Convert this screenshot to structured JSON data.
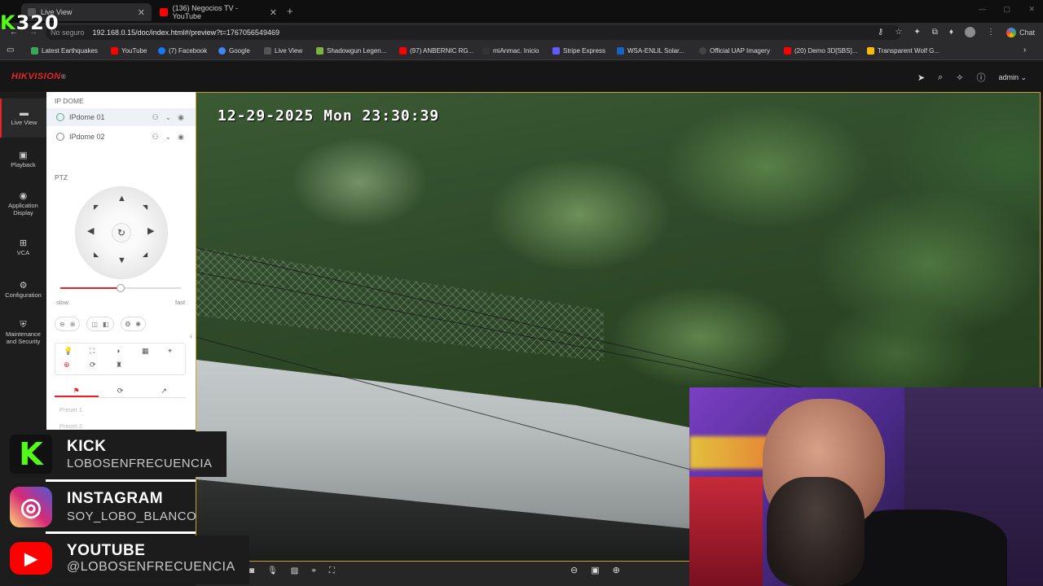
{
  "browser": {
    "tabs": [
      {
        "label": "Live View",
        "active": true
      },
      {
        "label": "(136) Negocios TV - YouTube",
        "active": false
      }
    ],
    "security_label": "No seguro",
    "url": "192.168.0.15/doc/index.html#/preview?t=1767056549469",
    "chat_label": "Chat",
    "bookmarks": [
      {
        "label": "Latest Earthquakes",
        "color": "#3aa757"
      },
      {
        "label": "YouTube",
        "color": "#ff0000"
      },
      {
        "label": "(7) Facebook",
        "color": "#1877f2"
      },
      {
        "label": "Google",
        "color": "#4285f4"
      },
      {
        "label": "Live View",
        "color": "#555555"
      },
      {
        "label": "Shadowgun Legen...",
        "color": "#7cb342"
      },
      {
        "label": "(97) ANBERNIC RG...",
        "color": "#ff0000"
      },
      {
        "label": "miAnmac. Inicio",
        "color": "#333333"
      },
      {
        "label": "Stripe Express",
        "color": "#635bff"
      },
      {
        "label": "WSA-ENLIL Solar...",
        "color": "#1565c0"
      },
      {
        "label": "Official UAP Imagery",
        "color": "#444444"
      },
      {
        "label": "(20) Demo 3D[SBS]...",
        "color": "#ff0000"
      },
      {
        "label": "Transparent Wolf G...",
        "color": "#fbbc05"
      }
    ]
  },
  "overlay_counter": {
    "k": "K",
    "number": "320"
  },
  "hikvision": {
    "logo_hik": "HIK",
    "logo_vision": "VISION",
    "logo_mark": "®",
    "user": "admin",
    "nav": [
      {
        "label": "Live View",
        "icon": "▬",
        "active": true
      },
      {
        "label": "Playback",
        "icon": "▣",
        "active": false
      },
      {
        "label": "Application Display",
        "icon": "◉",
        "active": false
      },
      {
        "label": "VCA",
        "icon": "⊞",
        "active": false
      },
      {
        "label": "Configuration",
        "icon": "⚙",
        "active": false
      },
      {
        "label": "Maintenance and Security",
        "icon": "⛨",
        "active": false
      }
    ],
    "group_label": "IP DOME",
    "cameras": [
      {
        "name": "IPdome 01",
        "selected": true
      },
      {
        "name": "IPdome 02",
        "selected": false
      }
    ],
    "ptz_label": "PTZ",
    "speed": {
      "slow_label": "slow",
      "fast_label": "fast",
      "level": 0.5
    },
    "presets": [
      "Preset 1",
      "Preset 2"
    ]
  },
  "video": {
    "timestamp": "12-29-2025 Mon 23:30:39"
  },
  "social": [
    {
      "title": "KICK",
      "handle": "LOBOSENFRECUENCIA",
      "icon": "K",
      "color": "#53fc18"
    },
    {
      "title": "INSTAGRAM",
      "handle": "SOY_LOBO_BLANCO",
      "icon": "◎",
      "color": "#d6249f"
    },
    {
      "title": "YOUTUBE",
      "handle": "@LOBOSENFRECUENCIA",
      "icon": "▶",
      "color": "#ff0000"
    }
  ]
}
